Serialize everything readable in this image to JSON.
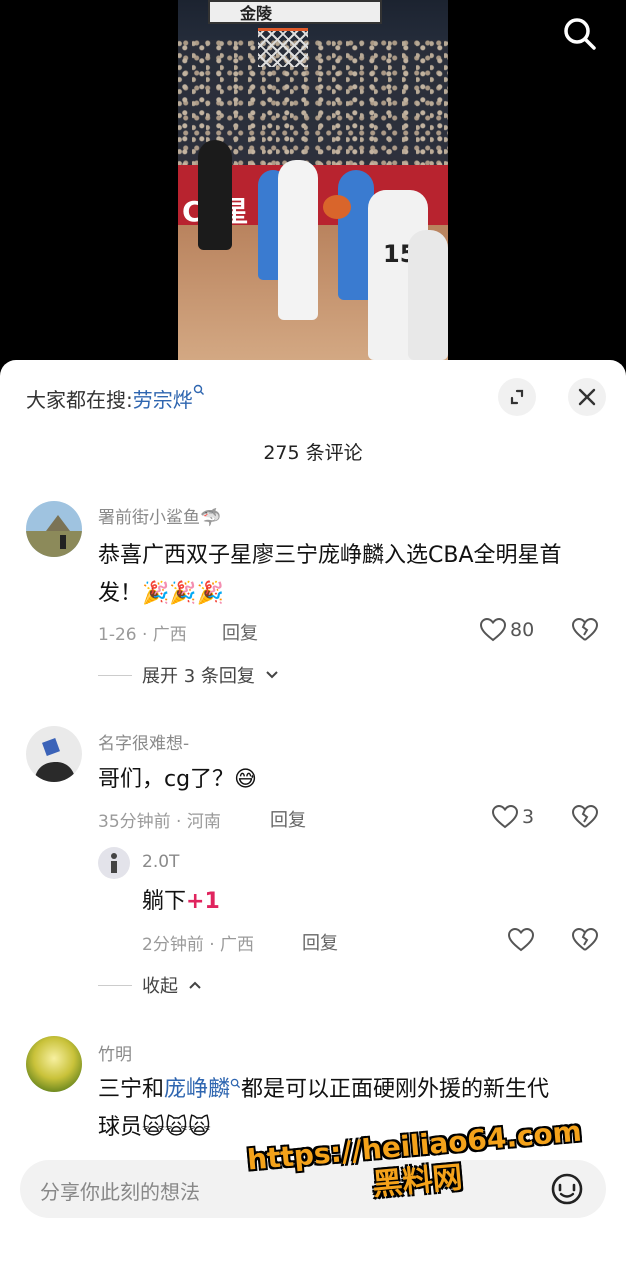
{
  "video": {
    "backboard_text": "金陵",
    "banner_text": "CL星",
    "jersey_number": "15"
  },
  "sheet": {
    "everyone_search_label": "大家都在搜:",
    "everyone_search_term": "劳宗烨",
    "comment_count_title": "275 条评论"
  },
  "comments": [
    {
      "username": "署前街小鲨鱼🦈",
      "text_line1": "恭喜广西双子星廖三宁庞峥麟入选CBA全明星首",
      "text_line2": "发！🎉🎉🎉",
      "meta": "1-26 · 广西",
      "reply_label": "回复",
      "likes": "80",
      "expand_label": "展开 3 条回复"
    },
    {
      "username": "名字很难想-",
      "text": "哥们，cg了？😅",
      "meta": "35分钟前 · 河南",
      "reply_label": "回复",
      "likes": "3",
      "reply": {
        "username": "2.0T",
        "text": "躺下",
        "plus": "+1",
        "meta": "2分钟前 · 广西",
        "reply_label": "回复"
      },
      "collapse_label": "收起"
    },
    {
      "username": "竹明",
      "text_prefix": "三宁和",
      "text_link": "庞峥麟",
      "text_suffix": "都是可以正面硬刚外援的新生代",
      "text_line2": "球员🙀🙀🙀"
    }
  ],
  "input": {
    "placeholder": "分享你此刻的想法"
  },
  "watermark": {
    "url": "https://heiliao64.com",
    "name": "黑料网"
  },
  "colors": {
    "link_blue": "#2f66b0",
    "plus_red": "#e0245e",
    "watermark_orange": "#f4a21a"
  }
}
